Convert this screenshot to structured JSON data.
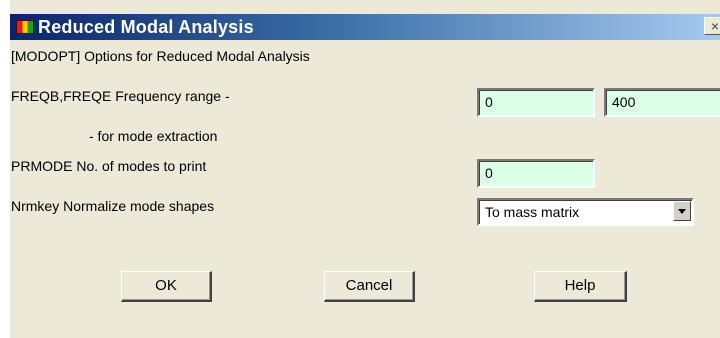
{
  "window": {
    "title": "Reduced Modal Analysis",
    "close_glyph": "×"
  },
  "dialog": {
    "heading": "[MODOPT]  Options for Reduced Modal Analysis",
    "rows": {
      "freq": {
        "label": "FREQB,FREQE  Frequency range -",
        "sublabel": "- for mode extraction",
        "freqb_value": "0",
        "freqe_value": "400"
      },
      "prmode": {
        "label": "PRMODE   No. of modes to print",
        "value": "0"
      },
      "nrmkey": {
        "label": "Nrmkey   Normalize mode shapes",
        "selected": "To mass matrix"
      }
    },
    "buttons": {
      "ok": "OK",
      "cancel": "Cancel",
      "help": "Help"
    }
  },
  "colors": {
    "title_gradient_start": "#0a246a",
    "field_bg": "#dcffe8",
    "dialog_bg": "#ece9d8"
  }
}
